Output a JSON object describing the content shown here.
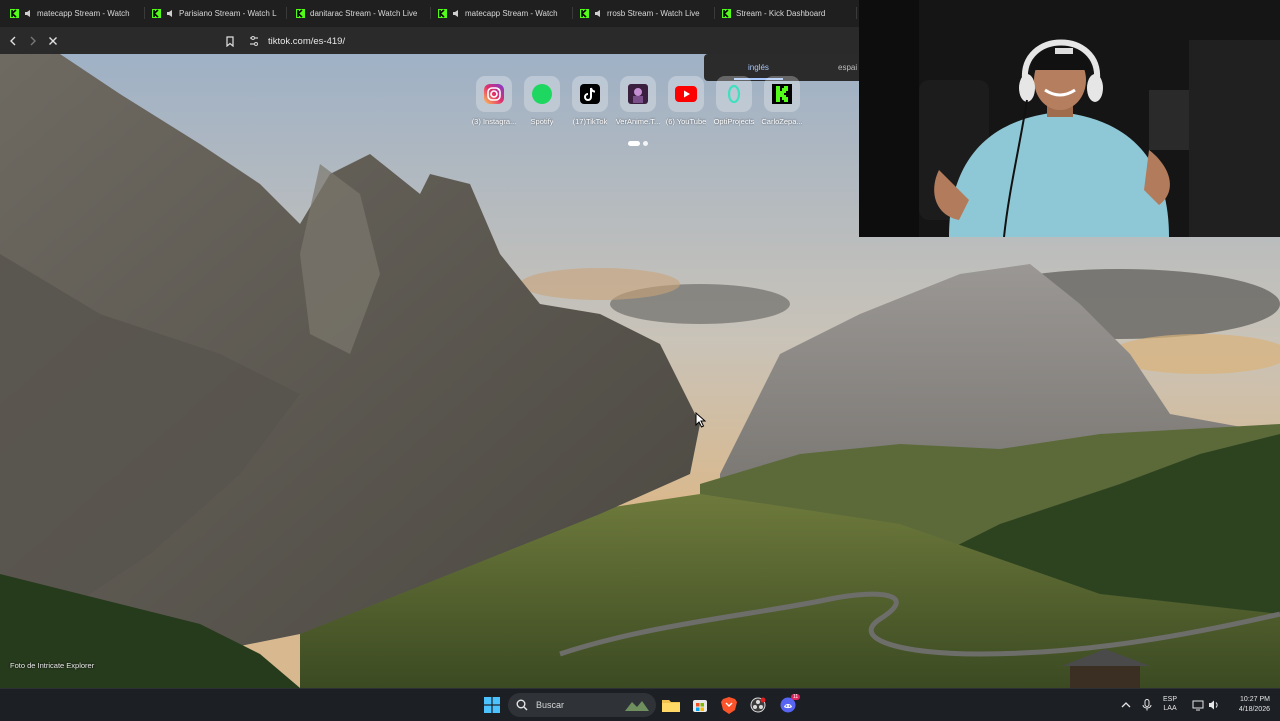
{
  "tabs": [
    {
      "label": "matecapp Stream - Watch",
      "audio": true
    },
    {
      "label": "Parisiano Stream - Watch L",
      "audio": true
    },
    {
      "label": "danitarac Stream - Watch Live",
      "audio": false
    },
    {
      "label": "matecapp Stream - Watch",
      "audio": true
    },
    {
      "label": "rrosb Stream - Watch Live",
      "audio": true
    },
    {
      "label": "Stream - Kick Dashboard",
      "audio": false
    }
  ],
  "address_bar": {
    "url": "tiktok.com/es-419/"
  },
  "translate_popup": {
    "option_active": "inglés",
    "option_other": "espai"
  },
  "shortcuts": [
    {
      "label": "(3) Instagra...",
      "icon": "instagram-icon"
    },
    {
      "label": "Spotify",
      "icon": "spotify-icon"
    },
    {
      "label": "(17)TikTok",
      "icon": "tiktok-icon"
    },
    {
      "label": "VerAnime.T...",
      "icon": "veranime-icon"
    },
    {
      "label": "(6) YouTube",
      "icon": "youtube-icon"
    },
    {
      "label": "OptiProjects",
      "icon": "optiprojects-icon"
    },
    {
      "label": "CarloZepa...",
      "icon": "kick-icon"
    }
  ],
  "photo_credit": "Foto de Intricate Explorer",
  "taskbar": {
    "search_label": "Buscar",
    "language_line1": "ESP",
    "language_line2": "LAA",
    "time": "10:27 PM",
    "date": "4/18/2026",
    "discord_badge": "11"
  },
  "colors": {
    "kick_green": "#53fc18",
    "youtube_red": "#ff0000",
    "instagram_pink": "#e1306c",
    "spotify_green": "#1ed760"
  }
}
